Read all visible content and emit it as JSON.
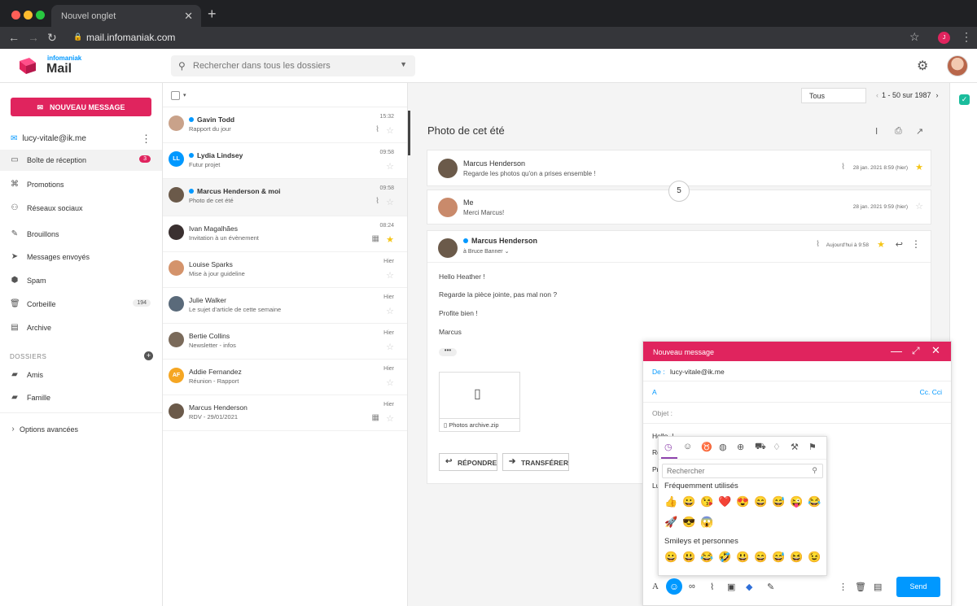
{
  "browser": {
    "tab_title": "Nouvel onglet",
    "url": "mail.infomaniak.com",
    "profile_initial": "J"
  },
  "app": {
    "brand_small": "infomaniak",
    "brand_name": "Mail",
    "search_placeholder": "Rechercher dans tous les dossiers"
  },
  "sidebar": {
    "new_message": "NOUVEAU MESSAGE",
    "account": "lucy-vitale@ik.me",
    "items": [
      {
        "label": "Boîte de réception",
        "count": "3"
      },
      {
        "label": "Promotions",
        "count": ""
      },
      {
        "label": "Réseaux sociaux",
        "count": ""
      },
      {
        "label": "Brouillons",
        "count": ""
      },
      {
        "label": "Messages envoyés",
        "count": ""
      },
      {
        "label": "Spam",
        "count": ""
      },
      {
        "label": "Corbeille",
        "count": "194"
      },
      {
        "label": "Archive",
        "count": ""
      }
    ],
    "dossiers_label": "DOSSIERS",
    "folders": [
      "Amis",
      "Famille"
    ],
    "advanced": "Options avancées"
  },
  "list": {
    "filter": "Tous",
    "pager": "1 - 50 sur 1987",
    "rows": [
      {
        "name": "Gavin Todd",
        "subject": "Rapport du jour",
        "time": "15:32",
        "unread": true
      },
      {
        "name": "Lydia Lindsey",
        "subject": "Futur projet",
        "time": "09:58",
        "unread": true,
        "initials": "LL"
      },
      {
        "name": "Marcus Henderson & moi",
        "subject": "Photo de cet été",
        "time": "09:58",
        "unread": true
      },
      {
        "name": "Ivan Magalhães",
        "subject": "Invitation à un évènement",
        "time": "08:24",
        "unread": false
      },
      {
        "name": "Louise Sparks",
        "subject": "Mise à jour guideline",
        "time": "Hier",
        "unread": false
      },
      {
        "name": "Julie Walker",
        "subject": "Le sujet d'article de cette semaine",
        "time": "Hier",
        "unread": false
      },
      {
        "name": "Bertie Collins",
        "subject": "Newsletter - infos",
        "time": "Hier",
        "unread": false
      },
      {
        "name": "Addie Fernandez",
        "subject": "Réunion - Rapport",
        "time": "Hier",
        "unread": false,
        "initials": "AF"
      },
      {
        "name": "Marcus Henderson",
        "subject": "RDV - 29/01/2021",
        "time": "Hier",
        "unread": false
      }
    ]
  },
  "thread": {
    "subject": "Photo de cet été",
    "messages": [
      {
        "name": "Marcus Henderson",
        "preview": "Regarde les photos qu'on a prises ensemble !",
        "date": "28 jan. 2021 8:59 (hier)"
      },
      {
        "name": "Me",
        "preview": "Merci Marcus!",
        "date": "28 jan. 2021 9:59 (hier)"
      },
      {
        "name": "Marcus Henderson",
        "to": "à Bruce Banner",
        "date": "Aujourd'hui à 9:58"
      }
    ],
    "collapsed_count": "5",
    "body": [
      "Hello Heather !",
      "Regarde la pièce jointe, pas mal non ?",
      "Profite bien !",
      "Marcus"
    ],
    "attachment": "Photos archive.zip",
    "reply": "RÉPONDRE",
    "forward": "TRANSFÉRER"
  },
  "compose": {
    "title": "Nouveau message",
    "from_label": "De :",
    "from_value": "lucy-vitale@ik.me",
    "to_label": "A",
    "cc": "Cc. Cci",
    "subject_label": "Objet :",
    "body_start": "Hello, !",
    "body_letters": [
      "Re",
      "Pr",
      "Lu"
    ],
    "send": "Send"
  },
  "emoji_picker": {
    "search_placeholder": "Rechercher",
    "section1": "Fréquemment utilisés",
    "section2": "Smileys et personnes",
    "frequent": [
      "👍",
      "😀",
      "😘",
      "❤️",
      "😍",
      "😄",
      "😅",
      "😜",
      "😂",
      "🚀",
      "😎",
      "😱"
    ],
    "smileys": [
      "😀",
      "😃",
      "😂",
      "🤣",
      "😃",
      "😄",
      "😅",
      "😆",
      "😉"
    ]
  }
}
